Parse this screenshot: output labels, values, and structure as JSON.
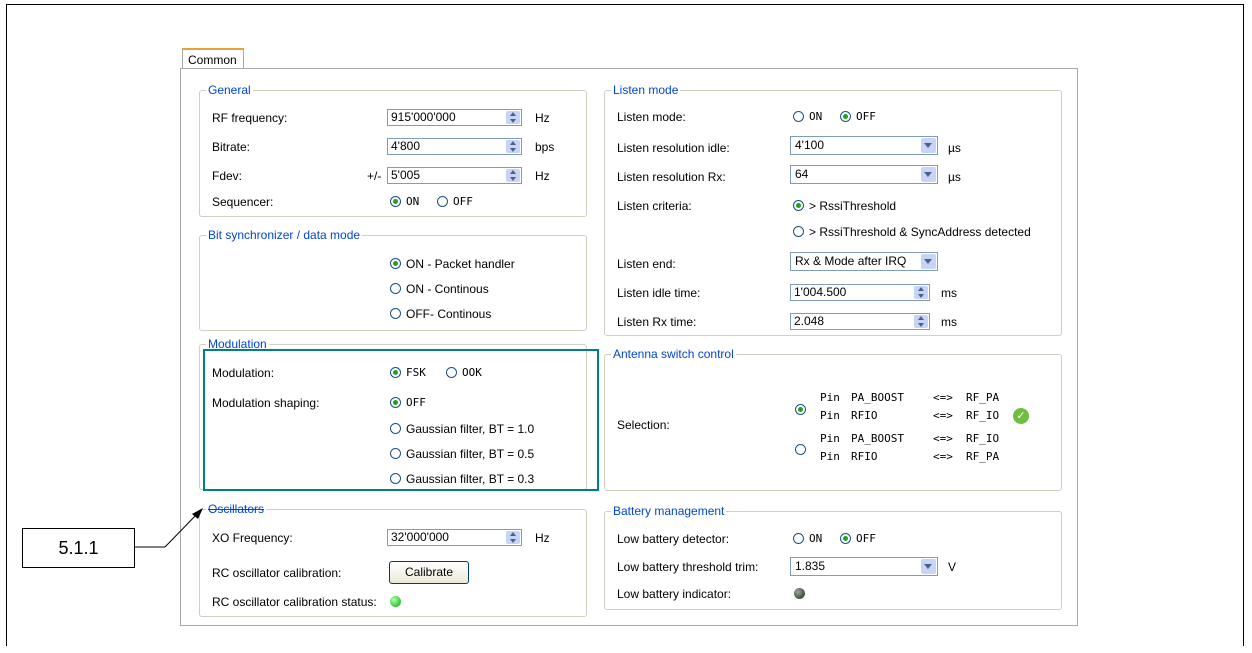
{
  "tab": {
    "label": "Common"
  },
  "general": {
    "title": "General",
    "rf_label": "RF frequency:",
    "rf_value": "915'000'000",
    "rf_unit": "Hz",
    "bitrate_label": "Bitrate:",
    "bitrate_value": "4'800",
    "bitrate_unit": "bps",
    "fdev_label": "Fdev:",
    "fdev_prefix": "+/-",
    "fdev_value": "5'005",
    "fdev_unit": "Hz",
    "seq_label": "Sequencer:",
    "seq_on": "ON",
    "seq_off": "OFF"
  },
  "bitsync": {
    "title": "Bit synchronizer / data mode",
    "opt1": "ON - Packet handler",
    "opt2": "ON - Continous",
    "opt3": "OFF- Continous"
  },
  "modulation": {
    "title": "Modulation",
    "mod_label": "Modulation:",
    "fsk": "FSK",
    "ook": "OOK",
    "shaping_label": "Modulation shaping:",
    "s_off": "OFF",
    "s1": "Gaussian filter, BT = 1.0",
    "s2": "Gaussian filter, BT = 0.5",
    "s3": "Gaussian filter, BT = 0.3"
  },
  "oscillators": {
    "title": "Oscillators",
    "xo_label": "XO Frequency:",
    "xo_value": "32'000'000",
    "xo_unit": "Hz",
    "rc_label": "RC oscillator calibration:",
    "calibrate": "Calibrate",
    "rc_status_label": "RC oscillator calibration status:"
  },
  "listen": {
    "title": "Listen mode",
    "mode_label": "Listen mode:",
    "on": "ON",
    "off": "OFF",
    "res_idle_label": "Listen resolution idle:",
    "res_idle_value": "4'100",
    "res_idle_unit": "µs",
    "res_rx_label": "Listen resolution Rx:",
    "res_rx_value": "64",
    "res_rx_unit": "µs",
    "criteria_label": "Listen criteria:",
    "crit1": "> RssiThreshold",
    "crit2": "> RssiThreshold & SyncAddress detected",
    "end_label": "Listen end:",
    "end_value": "Rx & Mode after IRQ",
    "idle_time_label": "Listen idle time:",
    "idle_time_value": "1'004.500",
    "idle_time_unit": "ms",
    "rx_time_label": "Listen Rx time:",
    "rx_time_value": "2.048",
    "rx_time_unit": "ms"
  },
  "antenna": {
    "title": "Antenna switch control",
    "selection_label": "Selection:",
    "rows": [
      {
        "pin": "Pin",
        "name": "PA_BOOST",
        "arrow": "<=>",
        "target": "RF_PA"
      },
      {
        "pin": "Pin",
        "name": "RFIO",
        "arrow": "<=>",
        "target": "RF_IO"
      },
      {
        "pin": "Pin",
        "name": "PA_BOOST",
        "arrow": "<=>",
        "target": "RF_IO"
      },
      {
        "pin": "Pin",
        "name": "RFIO",
        "arrow": "<=>",
        "target": "RF_PA"
      }
    ]
  },
  "battery": {
    "title": "Battery management",
    "detector_label": "Low battery detector:",
    "on": "ON",
    "off": "OFF",
    "trim_label": "Low battery threshold trim:",
    "trim_value": "1.835",
    "trim_unit": "V",
    "indicator_label": "Low battery indicator:"
  },
  "callout": {
    "label": "5.1.1"
  },
  "colors": {
    "group_title": "#0046d5",
    "highlight": "#008080",
    "led_green": "#3fd43f",
    "led_dark": "#4a5a4a"
  }
}
